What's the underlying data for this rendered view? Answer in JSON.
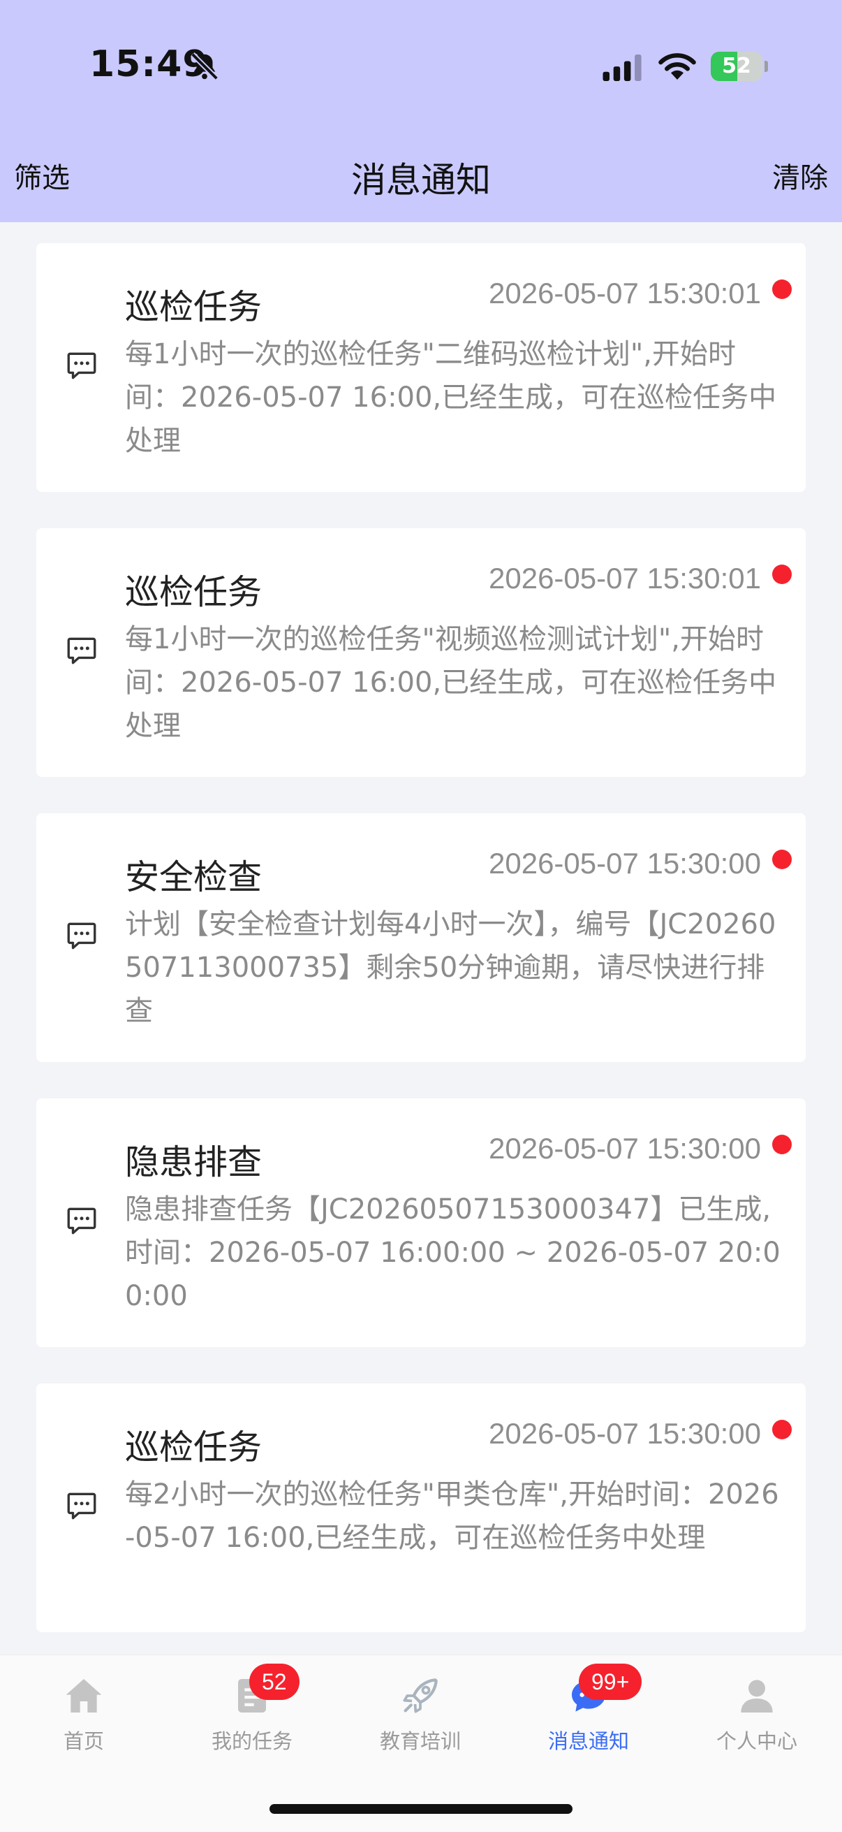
{
  "status_bar": {
    "time": "15:49",
    "battery_level": "52",
    "battery_fraction": 0.52,
    "battery_color": "#34c759"
  },
  "nav": {
    "left": "筛选",
    "title": "消息通知",
    "right": "清除",
    "background": "#c9c9fd"
  },
  "messages": [
    {
      "title": "巡检任务",
      "time": "2026-05-07 15:30:01",
      "body": "每1小时一次的巡检任务\"二维码巡检计划\",开始时间：2026-05-07 16:00,已经生成，可在巡检任务中处理",
      "icon": "message-icon",
      "unread": true
    },
    {
      "title": "巡检任务",
      "time": "2026-05-07 15:30:01",
      "body": "每1小时一次的巡检任务\"视频巡检测试计划\",开始时间：2026-05-07 16:00,已经生成，可在巡检任务中处理",
      "icon": "message-icon",
      "unread": true
    },
    {
      "title": "安全检查",
      "time": "2026-05-07 15:30:00",
      "body": "计划【安全检查计划每4小时一次】，编号【JC20260507113000735】剩余50分钟逾期，请尽快进行排查",
      "icon": "message-icon",
      "unread": true
    },
    {
      "title": "隐患排查",
      "time": "2026-05-07 15:30:00",
      "body": "隐患排查任务【JC20260507153000347】已生成,时间：2026-05-07 16:00:00 ~ 2026-05-07 20:00:00",
      "icon": "message-icon",
      "unread": true
    },
    {
      "title": "巡检任务",
      "time": "2026-05-07 15:30:00",
      "body": "每2小时一次的巡检任务\"甲类仓库\",开始时间：2026-05-07 16:00,已经生成，可在巡检任务中处理",
      "icon": "message-icon",
      "unread": true
    }
  ],
  "tabbar": {
    "active_color": "#3b6cf5",
    "items": [
      {
        "label": "首页",
        "icon": "home-icon"
      },
      {
        "label": "我的任务",
        "icon": "task-icon",
        "badge": "52"
      },
      {
        "label": "教育培训",
        "icon": "rocket-icon"
      },
      {
        "label": "消息通知",
        "icon": "chat-icon",
        "badge": "99+",
        "active": true
      },
      {
        "label": "个人中心",
        "icon": "person-icon"
      }
    ]
  }
}
